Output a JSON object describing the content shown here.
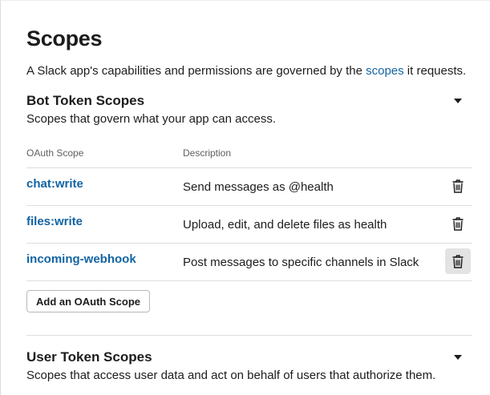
{
  "page": {
    "title": "Scopes",
    "intro_before": "A Slack app's capabilities and permissions are governed by the ",
    "intro_link": "scopes",
    "intro_after": " it requests."
  },
  "bot_section": {
    "title": "Bot Token Scopes",
    "description": "Scopes that govern what your app can access.",
    "expand_icon": "caret-down-icon",
    "columns": {
      "scope": "OAuth Scope",
      "description": "Description"
    },
    "rows": [
      {
        "scope": "chat:write",
        "description": "Send messages as @health",
        "icon": "trash-icon"
      },
      {
        "scope": "files:write",
        "description": "Upload, edit, and delete files as health",
        "icon": "trash-icon"
      },
      {
        "scope": "incoming-webhook",
        "description": "Post messages to specific channels in Slack",
        "icon": "trash-icon"
      }
    ],
    "add_button_label": "Add an OAuth Scope"
  },
  "user_section": {
    "title": "User Token Scopes",
    "description": "Scopes that access user data and act on behalf of users that authorize them.",
    "expand_icon": "caret-down-icon"
  },
  "colors": {
    "link": "#1264a3",
    "text": "#1d1c1d",
    "muted": "#616061",
    "border": "#dddddd",
    "hover_bg": "#e3e3e3"
  }
}
